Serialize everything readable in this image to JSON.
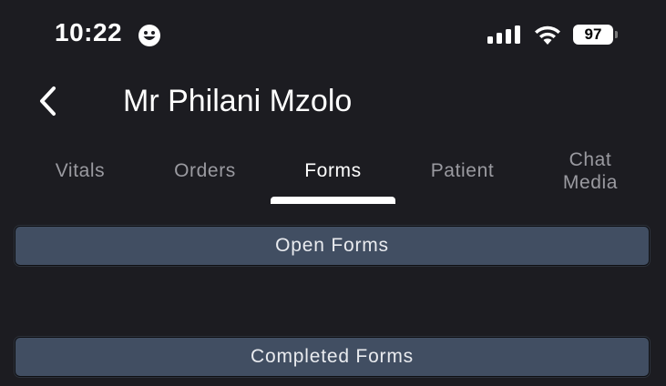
{
  "status_bar": {
    "time": "10:22",
    "battery_level": "97",
    "icons": [
      "smiley-face-icon",
      "cellular-signal-icon",
      "wifi-icon",
      "battery-icon"
    ]
  },
  "header": {
    "back_icon": "chevron-left-icon",
    "title": "Mr Philani Mzolo"
  },
  "tabs": [
    {
      "label": "Vitals",
      "active": false
    },
    {
      "label": "Orders",
      "active": false
    },
    {
      "label": "Forms",
      "active": true
    },
    {
      "label": "Patient",
      "active": false
    },
    {
      "label": "Chat",
      "label_line2": "Media",
      "active": false
    }
  ],
  "sections": {
    "open_forms_label": "Open Forms",
    "completed_forms_label": "Completed Forms"
  },
  "colors": {
    "background": "#1c1c21",
    "button_fill": "#414e62",
    "tab_inactive": "#9a9aa0",
    "tab_active": "#ffffff"
  }
}
